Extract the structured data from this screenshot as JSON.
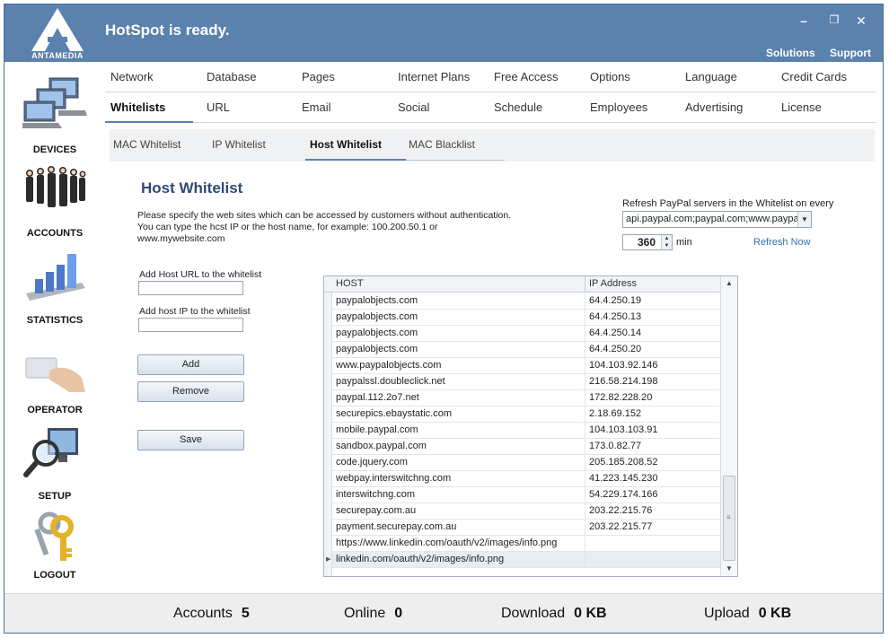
{
  "window": {
    "title": "HotSpot is ready.",
    "logo_text": "ANTAMEDIA",
    "controls": {
      "minimize": "–",
      "maximize": "❐",
      "close": "✕"
    },
    "links": {
      "solutions": "Solutions",
      "support": "Support"
    }
  },
  "sidebar": {
    "items": [
      {
        "label": "DEVICES",
        "icon": "devices-icon"
      },
      {
        "label": "ACCOUNTS",
        "icon": "accounts-icon"
      },
      {
        "label": "STATISTICS",
        "icon": "statistics-icon"
      },
      {
        "label": "OPERATOR",
        "icon": "operator-icon"
      },
      {
        "label": "SETUP",
        "icon": "setup-icon"
      },
      {
        "label": "LOGOUT",
        "icon": "logout-icon"
      }
    ]
  },
  "tabs": {
    "row1": [
      "Network",
      "Database",
      "Pages",
      "Internet Plans",
      "Free Access",
      "Options",
      "Language",
      "Credit Cards"
    ],
    "row2": [
      "Whitelists",
      "URL",
      "Email",
      "Social",
      "Schedule",
      "Employees",
      "Advertising",
      "License"
    ],
    "active": "Whitelists"
  },
  "subtabs": {
    "items": [
      "MAC Whitelist",
      "IP Whitelist",
      "Host Whitelist",
      "MAC Blacklist"
    ],
    "active": "Host Whitelist"
  },
  "content": {
    "title": "Host Whitelist",
    "desc_line1": "Please specify the web sites which can be accessed by customers without authentication.",
    "desc_line2": "You can type the hcst IP or the host name, for example:  100.200.50.1  or",
    "desc_line3": "www.mywebsite.com",
    "host_url_label": "Add Host URL to the whitelist",
    "host_url_value": "",
    "host_ip_label": "Add host IP to the whitelist",
    "host_ip_value": "",
    "add_label": "Add",
    "remove_label": "Remove",
    "save_label": "Save"
  },
  "refresh": {
    "label": "Refresh PayPal servers in the Whitelist on every",
    "servers_value": "api.paypal.com;paypal.com;www.paypal",
    "interval": "360",
    "unit": "min",
    "refresh_now": "Refresh Now"
  },
  "grid": {
    "headers": [
      "HOST",
      "IP Address"
    ],
    "rows": [
      {
        "host": "paypalobjects.com",
        "ip": "64.4.250.19"
      },
      {
        "host": "paypalobjects.com",
        "ip": "64.4.250.13"
      },
      {
        "host": "paypalobjects.com",
        "ip": "64.4.250.14"
      },
      {
        "host": "paypalobjects.com",
        "ip": "64.4.250.20"
      },
      {
        "host": "www.paypalobjects.com",
        "ip": "104.103.92.146"
      },
      {
        "host": "paypalssl.doubleclick.net",
        "ip": "216.58.214.198"
      },
      {
        "host": "paypal.112.2o7.net",
        "ip": "172.82.228.20"
      },
      {
        "host": "securepics.ebaystatic.com",
        "ip": "2.18.69.152"
      },
      {
        "host": "mobile.paypal.com",
        "ip": "104.103.103.91"
      },
      {
        "host": "sandbox.paypal.com",
        "ip": "173.0.82.77"
      },
      {
        "host": "code.jquery.com",
        "ip": "205.185.208.52"
      },
      {
        "host": "webpay.interswitchng.com",
        "ip": "41.223.145.230"
      },
      {
        "host": "interswitchng.com",
        "ip": "54.229.174.166"
      },
      {
        "host": "securepay.com.au",
        "ip": "203.22.215.76"
      },
      {
        "host": "payment.securepay.com.au",
        "ip": "203.22.215.77"
      },
      {
        "host": "https://www.linkedin.com/oauth/v2/images/info.png",
        "ip": ""
      },
      {
        "host": "linkedin.com/oauth/v2/images/info.png",
        "ip": ""
      }
    ],
    "selected_index": 16
  },
  "footer": {
    "accounts_label": "Accounts",
    "accounts_value": "5",
    "online_label": "Online",
    "online_value": "0",
    "download_label": "Download",
    "download_value": "0 KB",
    "upload_label": "Upload",
    "upload_value": "0 KB"
  },
  "colors": {
    "titlebar": "#5b81ad",
    "accent_text": "#2f4a73",
    "link": "#3a6fb3"
  }
}
